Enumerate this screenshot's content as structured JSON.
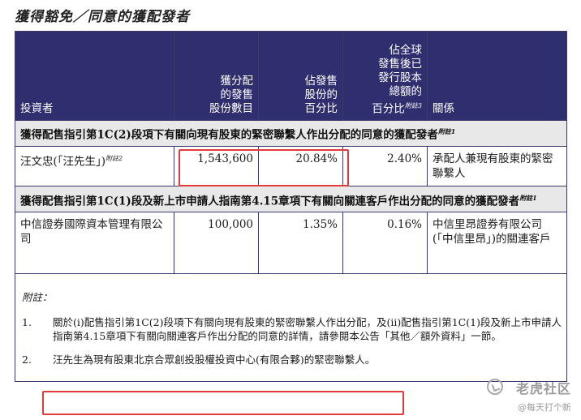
{
  "title": "獲得豁免／同意的獲配發者",
  "table": {
    "headers": {
      "investor": "投資者",
      "shares": "獲分配\n的發售\n股份數目",
      "pct_offer": "佔發售\n股份的\n百分比",
      "pct_total": "佔全球\n發售後已\n發行股本\n總額的\n百分比",
      "pct_total_note": "附註3",
      "relation": "關係"
    },
    "sections": [
      {
        "heading": "獲得配售指引第1C(2)段項下有關向現有股東的緊密聯繫人作出分配的同意的獲配發者",
        "heading_note": "附註1",
        "rows": [
          {
            "investor": "汪文忠(「汪先生」)",
            "investor_note": "附註2",
            "shares": "1,543,600",
            "pct_offer": "20.84%",
            "pct_total": "2.40%",
            "relation": "承配人兼現有股東的緊密聯繫人"
          }
        ]
      },
      {
        "heading": "獲得配售指引第1C(1)段及新上市申請人指南第4.15章項下有關向關連客戶作出分配的同意的獲配發者",
        "heading_note": "附註1",
        "rows": [
          {
            "investor": "中信證券國際資本管理有限公司",
            "investor_note": "",
            "shares": "100,000",
            "pct_offer": "1.35%",
            "pct_total": "0.16%",
            "relation": "中信里昂證券有限公司(「中信里昂」)的關連客戶"
          }
        ]
      }
    ]
  },
  "notes": {
    "heading": "附註：",
    "items": [
      {
        "num": "1.",
        "text": "關於(i)配售指引第1C(2)段項下有關向現有股東的緊密聯繫人作出分配，及(ii)配售指引第1C(1)段及新上市申請人指南第4.15章項下有關向關連客戶作出分配的同意的詳情，請參閱本公告「其他／額外資料」一節。"
      },
      {
        "num": "2.",
        "text": "汪先生為現有股東北京合眾創投股權投資中心(有限合夥)的緊密聯繫人。"
      }
    ]
  },
  "watermark": {
    "brand": "老虎社区",
    "handle": "@每天打个新"
  },
  "colors": {
    "header_bg": "#2f2e6e",
    "section_bg": "#e8e8e8",
    "highlight": "#e23b3b"
  }
}
